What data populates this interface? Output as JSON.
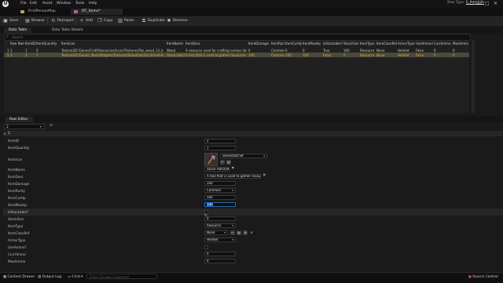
{
  "menu": [
    "File",
    "Edit",
    "Asset",
    "Window",
    "Tools",
    "Help"
  ],
  "row_type": {
    "label": "Row Type:",
    "value": "S_ItemInfo"
  },
  "window_buttons": [
    "—",
    "□",
    "✕"
  ],
  "tabs": [
    {
      "label": "FirstPersonMap",
      "color": "#c0a060"
    },
    {
      "label": "DT_Items*",
      "color": "#c85aa8"
    }
  ],
  "toolbar": {
    "save": "Save",
    "browse": "Browse",
    "reimport": "Reimport",
    "add": "Add",
    "copy": "Copy",
    "paste": "Paste",
    "duplicate": "Duplicate",
    "remove": "Remove"
  },
  "panel_tabs": [
    "Data Table",
    "Data Table Details"
  ],
  "search": {
    "placeholder": "Search"
  },
  "table": {
    "headers": [
      "",
      "Row Name",
      "ItemID",
      "ItemQuantity",
      "ItemIcon",
      "ItemName",
      "ItemDesc",
      "ItemDamage",
      "ItemRarity",
      "ItemCurHp",
      "ItemMaxHp",
      "IsStackable?",
      "StackSize",
      "ItemType",
      "ItemClassRef",
      "ArmorType",
      "UseAmmo?",
      "CurrAmmo",
      "MaxAmmo"
    ],
    "rows": [
      [
        "1",
        "1",
        "1",
        "0",
        "Texture2D'/Game/Craft/Resources/Icons/Textures/Tex_wood_13_b.Tex_w...",
        "Wood",
        "A resource used for crafting various items",
        "0",
        "Common",
        "0",
        "0",
        "True",
        "100",
        "Resource",
        "None",
        "Helmet",
        "False",
        "0",
        "0"
      ],
      [
        "2",
        "2",
        "2",
        "1",
        "Texture2D'/Game/_Main/Widgets/Textures/Stonehatchet.Stonehatchet",
        "Stone Hatchet",
        "A tool that is used to gather resources",
        "100",
        "Common",
        "100",
        "100",
        "False",
        "0",
        "Resource",
        "None",
        "Helmet",
        "False",
        "0",
        "0"
      ]
    ]
  },
  "row_editor": {
    "tab": "Row Editor",
    "selected_row": "2",
    "section": "2",
    "labels": [
      "ItemID",
      "ItemQuantity",
      "ItemIcon",
      "ItemName",
      "ItemDesc",
      "ItemDamage",
      "ItemRarity",
      "ItemCurHp",
      "ItemMaxHp",
      "IsStackable?",
      "StackSize",
      "ItemType",
      "ItemClassRef",
      "ArmorType",
      "UseAmmo?",
      "CurrAmmo",
      "MaxAmmo"
    ],
    "values": {
      "item_id": "2",
      "item_quantity": "1",
      "item_icon": "Stonehatchet",
      "item_name": "Stone Hatchet",
      "item_desc": "A tool that is used to gather resources",
      "item_damage": "100",
      "item_rarity": "Common",
      "item_cur_hp": "100",
      "item_max_hp": "100",
      "stack_size": "0",
      "item_type": "Resource",
      "item_class_ref": "None",
      "armor_type": "Helmet",
      "curr_ammo": "0",
      "max_ammo": "0"
    }
  },
  "status": {
    "content_drawer": "Content Drawer",
    "output_log": "Output Log",
    "cmd": "Cmd",
    "cmd_placeholder": "Enter Console Command",
    "source_control": "Source Control"
  },
  "colors": {
    "accent": "#0070e0",
    "selected_row": "#4a4a3a",
    "selected_text": "#f0a830"
  }
}
